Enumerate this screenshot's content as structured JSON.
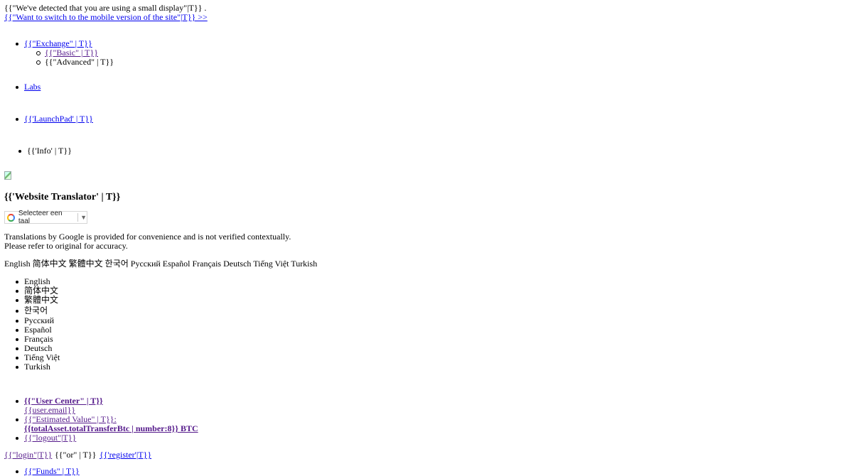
{
  "notice": {
    "small_display": "{{\"We've detected that you are using a small display\"|T}} .",
    "mobile_link": "{{\"Want to switch to the mobile version of the site\"|T}} >>"
  },
  "nav": {
    "exchange": "{{\"Exchange\" | T}}",
    "basic": "{{\"Basic\" | T}}",
    "advanced": "{{\"Advanced\" | T}}",
    "labs": "Labs",
    "launchpad": "{{'LaunchPad' | T}}",
    "info": "{{'Info' | T}}"
  },
  "translator": {
    "heading": "{{'Website Translator' | T}}",
    "select_label": "Selecteer een taal",
    "select_arrow": "▼",
    "disclaimer_line1": "Translations by Google is provided for convenience and is not verified contextually.",
    "disclaimer_line2": "Please refer to original for accuracy.",
    "inline_languages": "English 简体中文 繁體中文 한국어 Русский Español Français Deutsch Tiếng Việt Turkish",
    "languages": [
      "English",
      "简体中文",
      "繁體中文",
      "한국어",
      "Русский",
      "Español",
      "Français",
      "Deutsch",
      "Tiếng Việt",
      "Turkish"
    ]
  },
  "user": {
    "user_center": "{{\"User Center\" | T}}",
    "email": "{{user.email}}",
    "estimated_value": "{{\"Estimated Value\" | T}}:",
    "total_asset": "{{totalAsset.totalTransferBtc | number:8}} BTC",
    "logout": "{{\"logout\"|T}}"
  },
  "auth": {
    "login": "{{\"login\"|T}}",
    "or": "{{\"or\" | T}}",
    "register": "{{'register'|T}}"
  },
  "funds": "{{\"Funds\" | T}}",
  "icons": {
    "google_logo": "google-g-icon",
    "broken_image": "broken-image-icon"
  },
  "colors": {
    "link": "#0000ee",
    "visited_link": "#551a8b",
    "text": "#000000"
  }
}
